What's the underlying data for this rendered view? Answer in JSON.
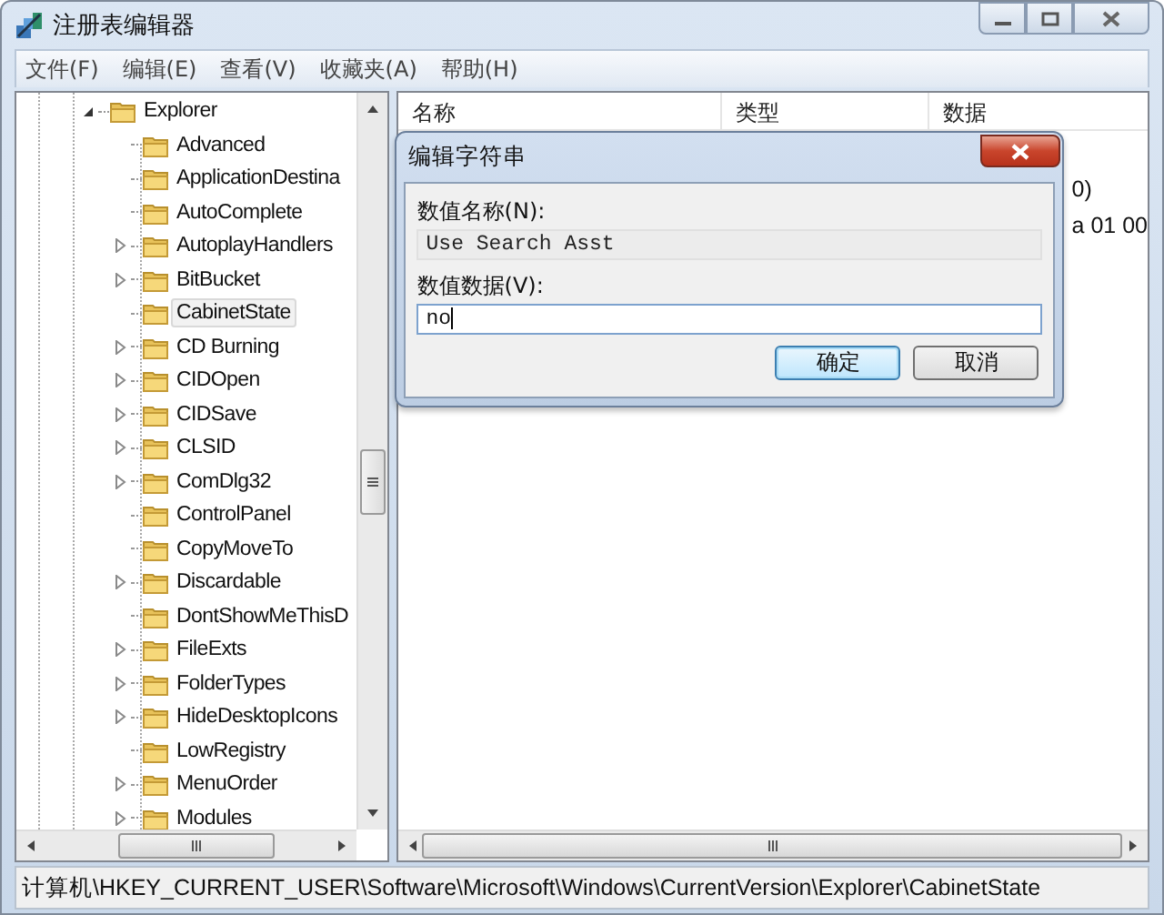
{
  "window": {
    "title": "注册表编辑器"
  },
  "menu": [
    "文件(F)",
    "编辑(E)",
    "查看(V)",
    "收藏夹(A)",
    "帮助(H)"
  ],
  "tree": {
    "items": [
      {
        "label": "Explorer",
        "expandable": true,
        "expanded": true,
        "selected": false,
        "children": [
          {
            "label": "Advanced",
            "expandable": false,
            "selected": false
          },
          {
            "label": "ApplicationDestina",
            "expandable": false,
            "selected": false
          },
          {
            "label": "AutoComplete",
            "expandable": false,
            "selected": false
          },
          {
            "label": "AutoplayHandlers",
            "expandable": true,
            "selected": false
          },
          {
            "label": "BitBucket",
            "expandable": true,
            "selected": false
          },
          {
            "label": "CabinetState",
            "expandable": false,
            "selected": true
          },
          {
            "label": "CD Burning",
            "expandable": true,
            "selected": false
          },
          {
            "label": "CIDOpen",
            "expandable": true,
            "selected": false
          },
          {
            "label": "CIDSave",
            "expandable": true,
            "selected": false
          },
          {
            "label": "CLSID",
            "expandable": true,
            "selected": false
          },
          {
            "label": "ComDlg32",
            "expandable": true,
            "selected": false
          },
          {
            "label": "ControlPanel",
            "expandable": false,
            "selected": false
          },
          {
            "label": "CopyMoveTo",
            "expandable": false,
            "selected": false
          },
          {
            "label": "Discardable",
            "expandable": true,
            "selected": false
          },
          {
            "label": "DontShowMeThisD",
            "expandable": false,
            "selected": false
          },
          {
            "label": "FileExts",
            "expandable": true,
            "selected": false
          },
          {
            "label": "FolderTypes",
            "expandable": true,
            "selected": false
          },
          {
            "label": "HideDesktopIcons",
            "expandable": true,
            "selected": false
          },
          {
            "label": "LowRegistry",
            "expandable": false,
            "selected": false
          },
          {
            "label": "MenuOrder",
            "expandable": true,
            "selected": false
          },
          {
            "label": "Modules",
            "expandable": true,
            "selected": false
          }
        ]
      }
    ]
  },
  "list": {
    "columns": [
      "名称",
      "类型",
      "数据"
    ],
    "rows": [
      {
        "data": "0)"
      },
      {
        "data": "a 01 00"
      }
    ]
  },
  "dialog": {
    "title": "编辑字符串",
    "name_label": "数值名称(N):",
    "name_value": "Use Search Asst",
    "data_label": "数值数据(V):",
    "data_value": "no",
    "buttons": [
      {
        "label": "确定",
        "default": true
      },
      {
        "label": "取消",
        "default": false
      }
    ]
  },
  "status_bar": "计算机\\HKEY_CURRENT_USER\\Software\\Microsoft\\Windows\\CurrentVersion\\Explorer\\CabinetState"
}
